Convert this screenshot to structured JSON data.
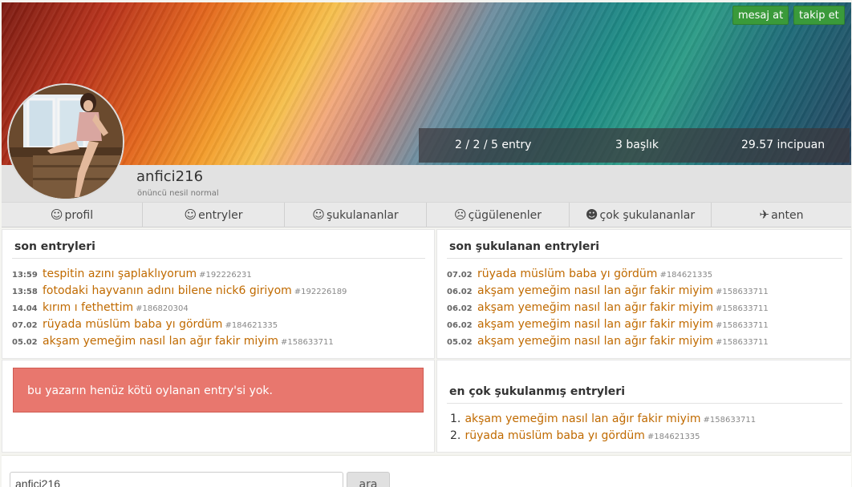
{
  "actions": {
    "message_label": "mesaj at",
    "follow_label": "takip et"
  },
  "stats": {
    "entries": "2 / 2 / 5 entry",
    "topics": "3 başlık",
    "points": "29.57 incipuan"
  },
  "user": {
    "name": "anfici216",
    "rank": "önüncü nesil normal"
  },
  "tabs": [
    {
      "icon": "☺",
      "label": "profil"
    },
    {
      "icon": "☺",
      "label": "entryler"
    },
    {
      "icon": "☺",
      "label": "şukulananlar"
    },
    {
      "icon": "☹",
      "label": "çügülenenler"
    },
    {
      "icon": "☻",
      "label": "çok şukulananlar"
    },
    {
      "icon": "✈",
      "label": "anten"
    }
  ],
  "recent": {
    "title": "son entryleri",
    "items": [
      {
        "time": "13:59",
        "title": "tespitin azını şaplaklıyorum",
        "id": "#192226231"
      },
      {
        "time": "13:58",
        "title": "fotodaki hayvanın adını bilene nick6 giriyom",
        "id": "#192226189"
      },
      {
        "time": "14.04",
        "title": "kırım ı fethettim",
        "id": "#186820304"
      },
      {
        "time": "07.02",
        "title": "rüyada müslüm baba yı gördüm",
        "id": "#184621335"
      },
      {
        "time": "05.02",
        "title": "akşam yemeğim nasıl lan ağır fakir miyim",
        "id": "#158633711"
      }
    ]
  },
  "liked": {
    "title": "son şukulanan entryleri",
    "items": [
      {
        "time": "07.02",
        "title": "rüyada müslüm baba yı gördüm",
        "id": "#184621335"
      },
      {
        "time": "06.02",
        "title": "akşam yemeğim nasıl lan ağır fakir miyim",
        "id": "#158633711"
      },
      {
        "time": "06.02",
        "title": "akşam yemeğim nasıl lan ağır fakir miyim",
        "id": "#158633711"
      },
      {
        "time": "06.02",
        "title": "akşam yemeğim nasıl lan ağır fakir miyim",
        "id": "#158633711"
      },
      {
        "time": "05.02",
        "title": "akşam yemeğim nasıl lan ağır fakir miyim",
        "id": "#158633711"
      }
    ]
  },
  "alert": {
    "text": "bu yazarın henüz kötü oylanan entry'si yok."
  },
  "top": {
    "title": "en çok şukulanmış entryleri",
    "items": [
      {
        "num": "1.",
        "title": "akşam yemeğim nasıl lan ağır fakir miyim",
        "id": "#158633711"
      },
      {
        "num": "2.",
        "title": "rüyada müslüm baba yı gördüm",
        "id": "#184621335"
      }
    ]
  },
  "search": {
    "value": "anfici216",
    "button_label": "ara"
  }
}
